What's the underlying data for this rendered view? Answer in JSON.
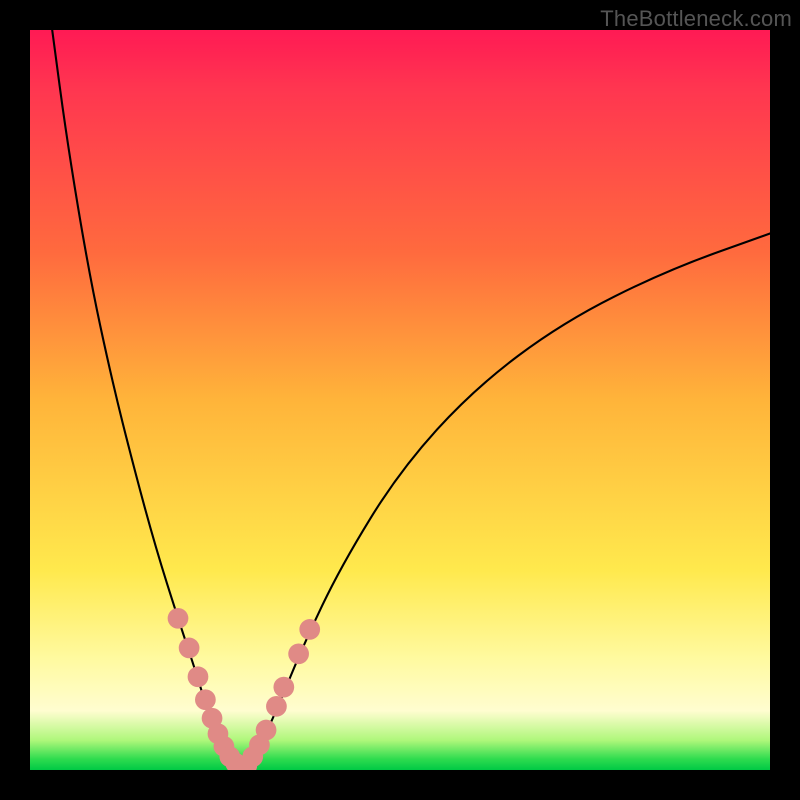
{
  "watermark": "TheBottleneck.com",
  "chart_data": {
    "type": "line",
    "title": "",
    "xlabel": "",
    "ylabel": "",
    "xlim": [
      0,
      100
    ],
    "ylim": [
      0,
      100
    ],
    "gradient_stops": [
      {
        "pos": 0.0,
        "color": "#ff1a54"
      },
      {
        "pos": 0.08,
        "color": "#ff3650"
      },
      {
        "pos": 0.3,
        "color": "#ff6a3e"
      },
      {
        "pos": 0.5,
        "color": "#ffb43a"
      },
      {
        "pos": 0.73,
        "color": "#ffe94d"
      },
      {
        "pos": 0.85,
        "color": "#fffaa0"
      },
      {
        "pos": 0.92,
        "color": "#fffdd0"
      },
      {
        "pos": 0.96,
        "color": "#aef77a"
      },
      {
        "pos": 0.985,
        "color": "#2fdc4f"
      },
      {
        "pos": 1.0,
        "color": "#00c945"
      }
    ],
    "series": [
      {
        "name": "left-branch",
        "x": [
          3.0,
          5.0,
          8.0,
          11.0,
          14.0,
          17.0,
          20.0,
          22.5,
          24.0,
          25.5,
          27.0,
          28.0
        ],
        "y": [
          100.0,
          85.0,
          67.0,
          53.0,
          41.0,
          30.0,
          20.5,
          13.0,
          8.0,
          4.5,
          1.5,
          0.4
        ]
      },
      {
        "name": "right-branch",
        "x": [
          29.0,
          31.0,
          33.5,
          37.0,
          42.0,
          50.0,
          60.0,
          72.0,
          86.0,
          100.0
        ],
        "y": [
          0.4,
          3.0,
          8.5,
          17.0,
          27.5,
          40.5,
          51.5,
          60.5,
          67.5,
          72.5
        ]
      },
      {
        "name": "valley-flat",
        "x": [
          28.0,
          28.5,
          29.0
        ],
        "y": [
          0.4,
          0.2,
          0.4
        ]
      }
    ],
    "markers": {
      "name": "highlight-dots",
      "color": "#e08a86",
      "radius": 1.4,
      "points": [
        {
          "x": 20.0,
          "y": 20.5
        },
        {
          "x": 21.5,
          "y": 16.5
        },
        {
          "x": 22.7,
          "y": 12.6
        },
        {
          "x": 23.7,
          "y": 9.5
        },
        {
          "x": 24.6,
          "y": 7.0
        },
        {
          "x": 25.4,
          "y": 4.9
        },
        {
          "x": 26.2,
          "y": 3.2
        },
        {
          "x": 27.0,
          "y": 1.8
        },
        {
          "x": 27.8,
          "y": 0.9
        },
        {
          "x": 28.5,
          "y": 0.3
        },
        {
          "x": 29.3,
          "y": 0.6
        },
        {
          "x": 30.1,
          "y": 1.8
        },
        {
          "x": 31.0,
          "y": 3.4
        },
        {
          "x": 31.9,
          "y": 5.4
        },
        {
          "x": 33.3,
          "y": 8.6
        },
        {
          "x": 34.3,
          "y": 11.2
        },
        {
          "x": 36.3,
          "y": 15.7
        },
        {
          "x": 37.8,
          "y": 19.0
        }
      ]
    }
  }
}
